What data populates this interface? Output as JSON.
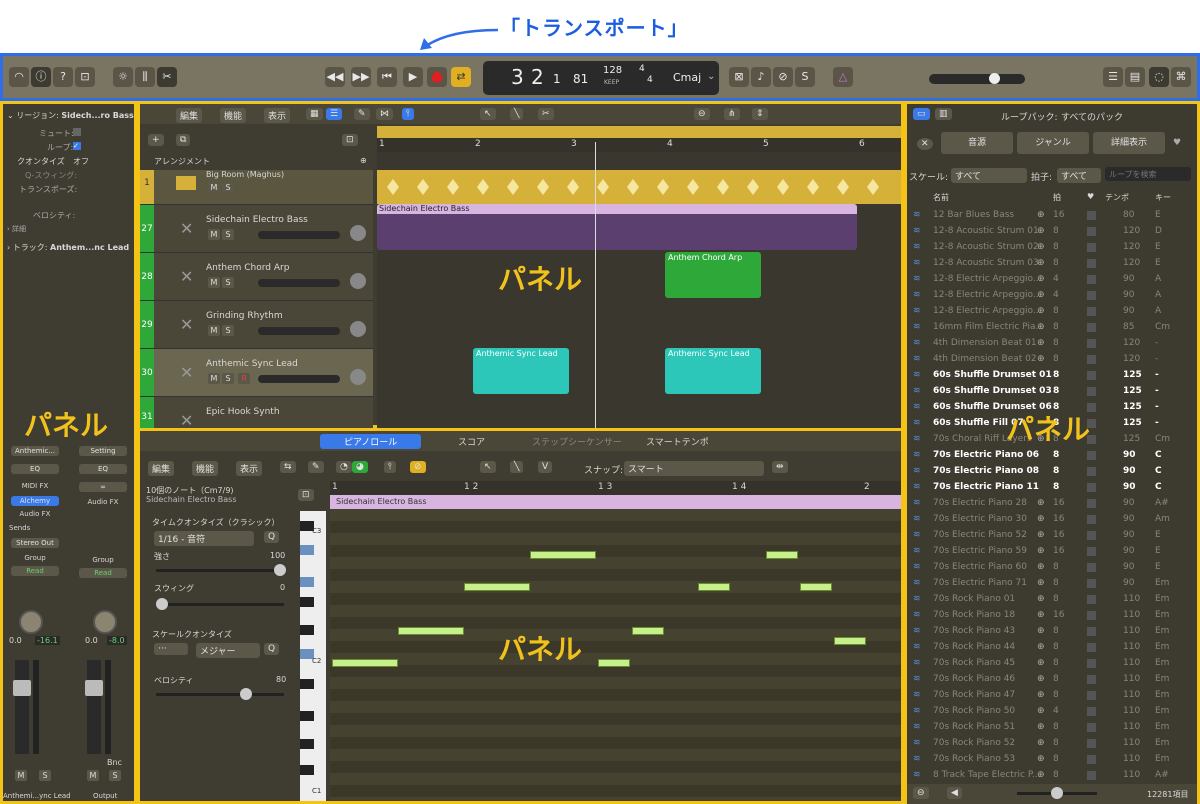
{
  "annotation": "「トランスポート」",
  "panel_labels": [
    "パネル",
    "パネル",
    "パネル",
    "パネル"
  ],
  "transport": {
    "position": "3 2 1 81",
    "bar": "3",
    "beat": "2",
    "div": "1",
    "tick": "81",
    "tempo": "128",
    "keep": "KEEP",
    "sig_top": "4",
    "sig_bottom": "4",
    "key": "Cmaj"
  },
  "inspector": {
    "region_label": "リージョン:",
    "region_name": "Sidech...ro Bass",
    "mute": "ミュート:",
    "loop": "ループ:",
    "quantize": "クオンタイズ",
    "quantize_val": "オフ",
    "q_swing": "Q-スウィング:",
    "transpose": "トランスポーズ:",
    "velocity": "ベロシティ:",
    "detail": "詳細",
    "track_label": "トラック:",
    "track_name": "Anthem...nc Lead",
    "strip1": {
      "setting": "Anthemic...",
      "eq": "EQ",
      "midi_fx": "MIDI FX",
      "inst": "Alchemy",
      "afx": "Audio FX",
      "sends": "Sends",
      "out": "Stereo Out",
      "group": "Group",
      "auto": "Read",
      "vol": "0.0",
      "peak": "-16.1",
      "name": "Anthemi...ync Lead"
    },
    "strip2": {
      "setting": "Setting",
      "eq": "EQ",
      "afx": "Audio FX",
      "group": "Group",
      "auto": "Read",
      "vol": "0.0",
      "peak": "-8.0",
      "bnc": "Bnc",
      "name": "Output"
    },
    "m": "M",
    "s": "S"
  },
  "tracks_menu": {
    "edit": "編集",
    "func": "機能",
    "view": "表示"
  },
  "arrangement": "アレンジメント",
  "ruler": [
    "1",
    "2",
    "3",
    "4",
    "5",
    "6"
  ],
  "tracks": [
    {
      "num": "1",
      "name": "Big Room (Maghus)"
    },
    {
      "num": "27",
      "name": "Sidechain Electro Bass"
    },
    {
      "num": "28",
      "name": "Anthem Chord Arp"
    },
    {
      "num": "29",
      "name": "Grinding Rhythm"
    },
    {
      "num": "30",
      "name": "Anthemic Sync Lead"
    },
    {
      "num": "31",
      "name": "Epic Hook Synth"
    }
  ],
  "regions": {
    "bass": "Sidechain Electro Bass",
    "arp": "Anthem Chord Arp",
    "lead1": "Anthemic Sync Lead",
    "lead2": "Anthemic Sync Lead"
  },
  "editor": {
    "tabs": [
      "ピアノロール",
      "スコア",
      "ステップシーケンサー",
      "スマートテンポ"
    ],
    "edit": "編集",
    "func": "機能",
    "view": "表示",
    "snap_label": "スナップ:",
    "snap_val": "スマート",
    "notes_title": "10個のノート（Cm7/9)",
    "notes_sub": "Sidechain Electro Bass",
    "tq_label": "タイムクオンタイズ（クラシック）",
    "tq_val": "1/16 - 音符",
    "q": "Q",
    "strength": "強さ",
    "strength_val": "100",
    "swing": "スウィング",
    "swing_val": "0",
    "sq_label": "スケールクオンタイズ",
    "sq_val": "メジャー",
    "sq_dots": "···",
    "velocity": "ベロシティ",
    "velocity_val": "80",
    "ruler": [
      "1",
      "1 2",
      "1 3",
      "1 4",
      "2"
    ],
    "region": "Sidechain Electro Bass",
    "keys": [
      "C3",
      "C2",
      "C1"
    ]
  },
  "library": {
    "loop_pack_label": "ループパック:",
    "loop_pack_val": "すべてのパック",
    "tabs": [
      "音源",
      "ジャンル",
      "詳細表示"
    ],
    "scale_label": "スケール:",
    "scale_val": "すべて",
    "beat_label": "拍子:",
    "beat_val": "すべて",
    "search_ph": "ループを検索",
    "cols": [
      "名前",
      "拍",
      "テンポ",
      "キー"
    ],
    "count": "12281項目",
    "rows": [
      [
        "12 Bar Blues Bass",
        "16",
        "80",
        "E",
        0
      ],
      [
        "12-8 Acoustic Strum 01",
        "8",
        "120",
        "D",
        0
      ],
      [
        "12-8 Acoustic Strum 02",
        "8",
        "120",
        "E",
        0
      ],
      [
        "12-8 Acoustic Strum 03",
        "8",
        "120",
        "E",
        0
      ],
      [
        "12-8 Electric Arpeggio...",
        "4",
        "90",
        "A",
        0
      ],
      [
        "12-8 Electric Arpeggio...",
        "4",
        "90",
        "A",
        0
      ],
      [
        "12-8 Electric Arpeggio...",
        "8",
        "90",
        "A",
        0
      ],
      [
        "16mm Film Electric Pia...",
        "8",
        "85",
        "Cm",
        0
      ],
      [
        "4th Dimension Beat 01",
        "8",
        "120",
        "-",
        0
      ],
      [
        "4th Dimension Beat 02",
        "8",
        "120",
        "-",
        0
      ],
      [
        "60s Shuffle Drumset 01",
        "8",
        "125",
        "-",
        1
      ],
      [
        "60s Shuffle Drumset 03",
        "8",
        "125",
        "-",
        1
      ],
      [
        "60s Shuffle Drumset 06",
        "8",
        "125",
        "-",
        1
      ],
      [
        "60s Shuffle Fill 07",
        "8",
        "125",
        "-",
        1
      ],
      [
        "70s Choral Riff Layers",
        "8",
        "125",
        "Cm",
        0
      ],
      [
        "70s Electric Piano 06",
        "8",
        "90",
        "C",
        1
      ],
      [
        "70s Electric Piano 08",
        "8",
        "90",
        "C",
        1
      ],
      [
        "70s Electric Piano 11",
        "8",
        "90",
        "C",
        1
      ],
      [
        "70s Electric Piano 28",
        "16",
        "90",
        "A#",
        0
      ],
      [
        "70s Electric Piano 30",
        "16",
        "90",
        "Am",
        0
      ],
      [
        "70s Electric Piano 52",
        "16",
        "90",
        "E",
        0
      ],
      [
        "70s Electric Piano 59",
        "16",
        "90",
        "E",
        0
      ],
      [
        "70s Electric Piano 60",
        "8",
        "90",
        "E",
        0
      ],
      [
        "70s Electric Piano 71",
        "8",
        "90",
        "Em",
        0
      ],
      [
        "70s Rock Piano 01",
        "8",
        "110",
        "Em",
        0
      ],
      [
        "70s Rock Piano 18",
        "16",
        "110",
        "Em",
        0
      ],
      [
        "70s Rock Piano 43",
        "8",
        "110",
        "Em",
        0
      ],
      [
        "70s Rock Piano 44",
        "8",
        "110",
        "Em",
        0
      ],
      [
        "70s Rock Piano 45",
        "8",
        "110",
        "Em",
        0
      ],
      [
        "70s Rock Piano 46",
        "8",
        "110",
        "Em",
        0
      ],
      [
        "70s Rock Piano 47",
        "8",
        "110",
        "Em",
        0
      ],
      [
        "70s Rock Piano 50",
        "4",
        "110",
        "Em",
        0
      ],
      [
        "70s Rock Piano 51",
        "8",
        "110",
        "Em",
        0
      ],
      [
        "70s Rock Piano 52",
        "8",
        "110",
        "Em",
        0
      ],
      [
        "70s Rock Piano 53",
        "8",
        "110",
        "Em",
        0
      ],
      [
        "8 Track Tape Electric P...",
        "8",
        "110",
        "A#",
        0
      ]
    ]
  },
  "colors": {
    "accent": "#f3c415",
    "transport_border": "#2f6ee8",
    "arp": "#2fa83a",
    "lead": "#2cc7b9",
    "bass": "#5b3f6e",
    "drum": "#d6b13a"
  }
}
